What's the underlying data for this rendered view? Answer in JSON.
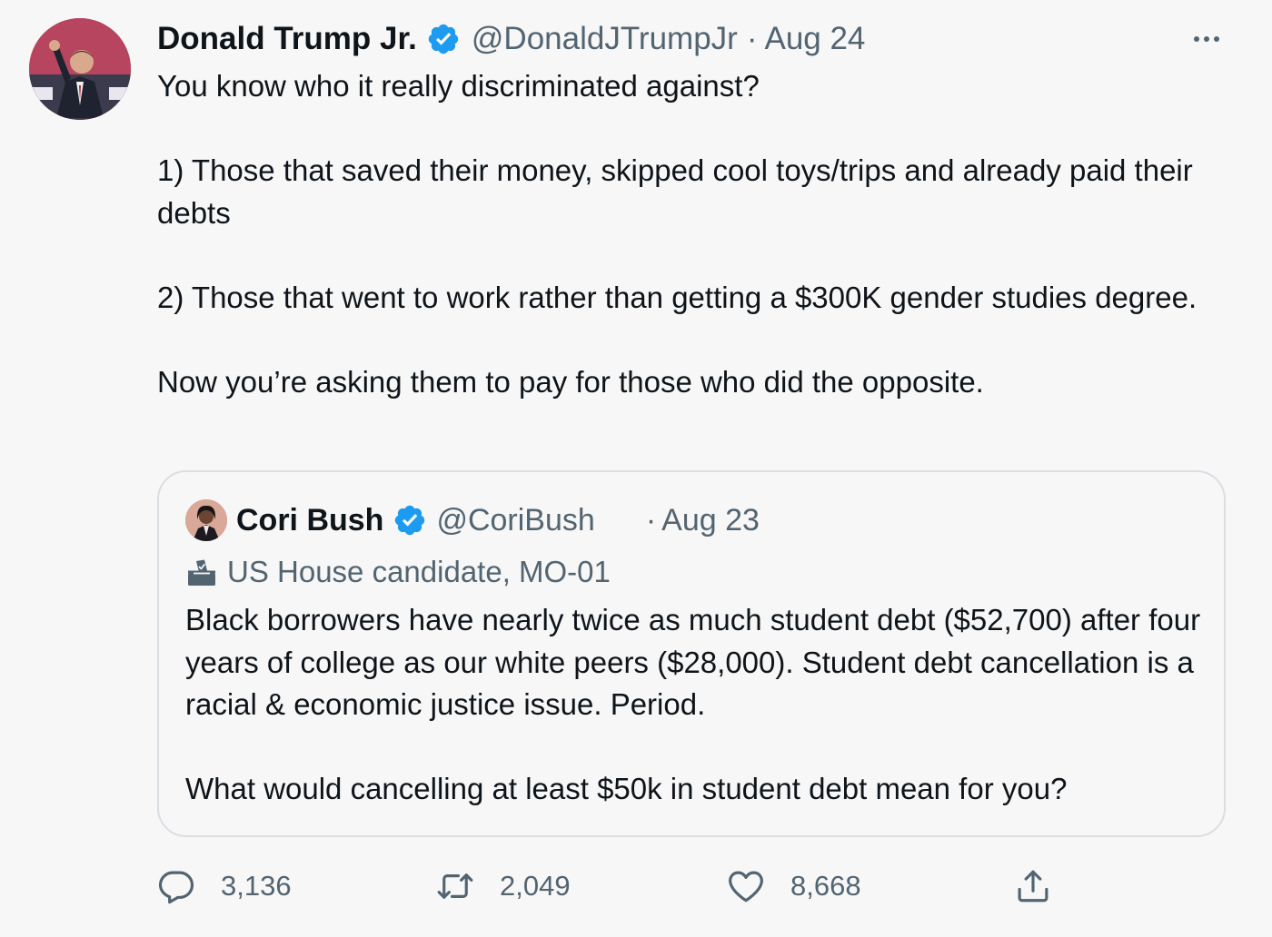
{
  "tweet": {
    "author_name": "Donald Trump Jr.",
    "handle": "@DonaldJTrumpJr",
    "separator": "·",
    "date": "Aug 24",
    "body": {
      "line1": "You know who it really discriminated against?",
      "line2": "1) Those that saved their money, skipped cool toys/trips and already paid their debts",
      "line3": "2) Those that went to work rather than getting a $300K gender studies degree.",
      "line4": "Now you’re asking them to pay for those who did the opposite."
    },
    "avatar_icon": "profile-photo",
    "verified_icon": "verified-badge-icon",
    "more_icon": "more-options-icon",
    "accent_color": "#1d9bf0"
  },
  "quoted_tweet": {
    "author_name": "Cori Bush",
    "handle": "@CoriBush",
    "separator": "·",
    "date": "Aug 23",
    "label": "US House candidate, MO-01",
    "label_icon": "ballot-box-icon",
    "body": {
      "para1": "Black borrowers have nearly twice as much student debt ($52,700) after four years of college as our white peers ($28,000). Student debt cancellation is a racial & economic justice issue. Period.",
      "para2": "What would cancelling at least $50k in student debt mean for you?"
    }
  },
  "actions": {
    "reply_count": "3,136",
    "retweet_count": "2,049",
    "like_count": "8,668",
    "reply_icon": "reply-icon",
    "retweet_icon": "retweet-icon",
    "like_icon": "heart-icon",
    "share_icon": "share-icon"
  }
}
